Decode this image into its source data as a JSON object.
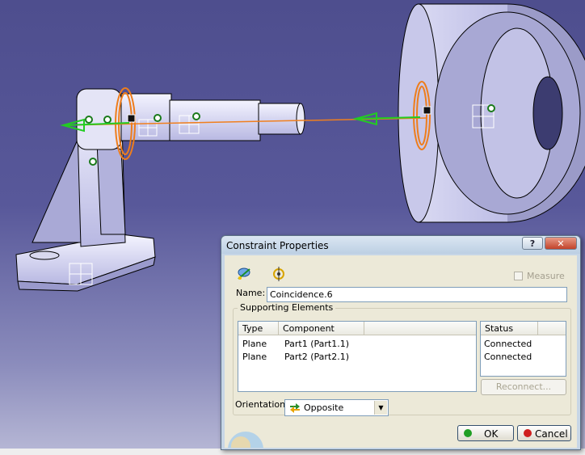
{
  "dialog": {
    "title": "Constraint Properties",
    "help_label": "?",
    "close_label": "✕",
    "measure_label": "Measure",
    "name_label": "Name:",
    "name_value": "Coincidence.6",
    "group_title": "Supporting Elements",
    "columns": [
      "Type",
      "Component"
    ],
    "status_column": "Status",
    "rows": [
      {
        "type": "Plane",
        "component": "Part1 (Part1.1)",
        "status": "Connected"
      },
      {
        "type": "Plane",
        "component": "Part2 (Part2.1)",
        "status": "Connected"
      }
    ],
    "reconnect_label": "Reconnect...",
    "orientation_label": "Orientation",
    "orientation_value": "Opposite",
    "ok_label": "OK",
    "cancel_label": "Cancel"
  },
  "colors": {
    "constraint_line": "#f07f1e",
    "arrow": "#22cc22",
    "highlight_circle": "#ee7d1c",
    "ok_led": "#1f9e24",
    "cancel_led": "#cf1f1f"
  },
  "icons": [
    "constraint-icon",
    "reference-icon",
    "orientation-icon",
    "help-icon",
    "close-icon",
    "dropdown-arrow-icon",
    "compass-icon"
  ]
}
